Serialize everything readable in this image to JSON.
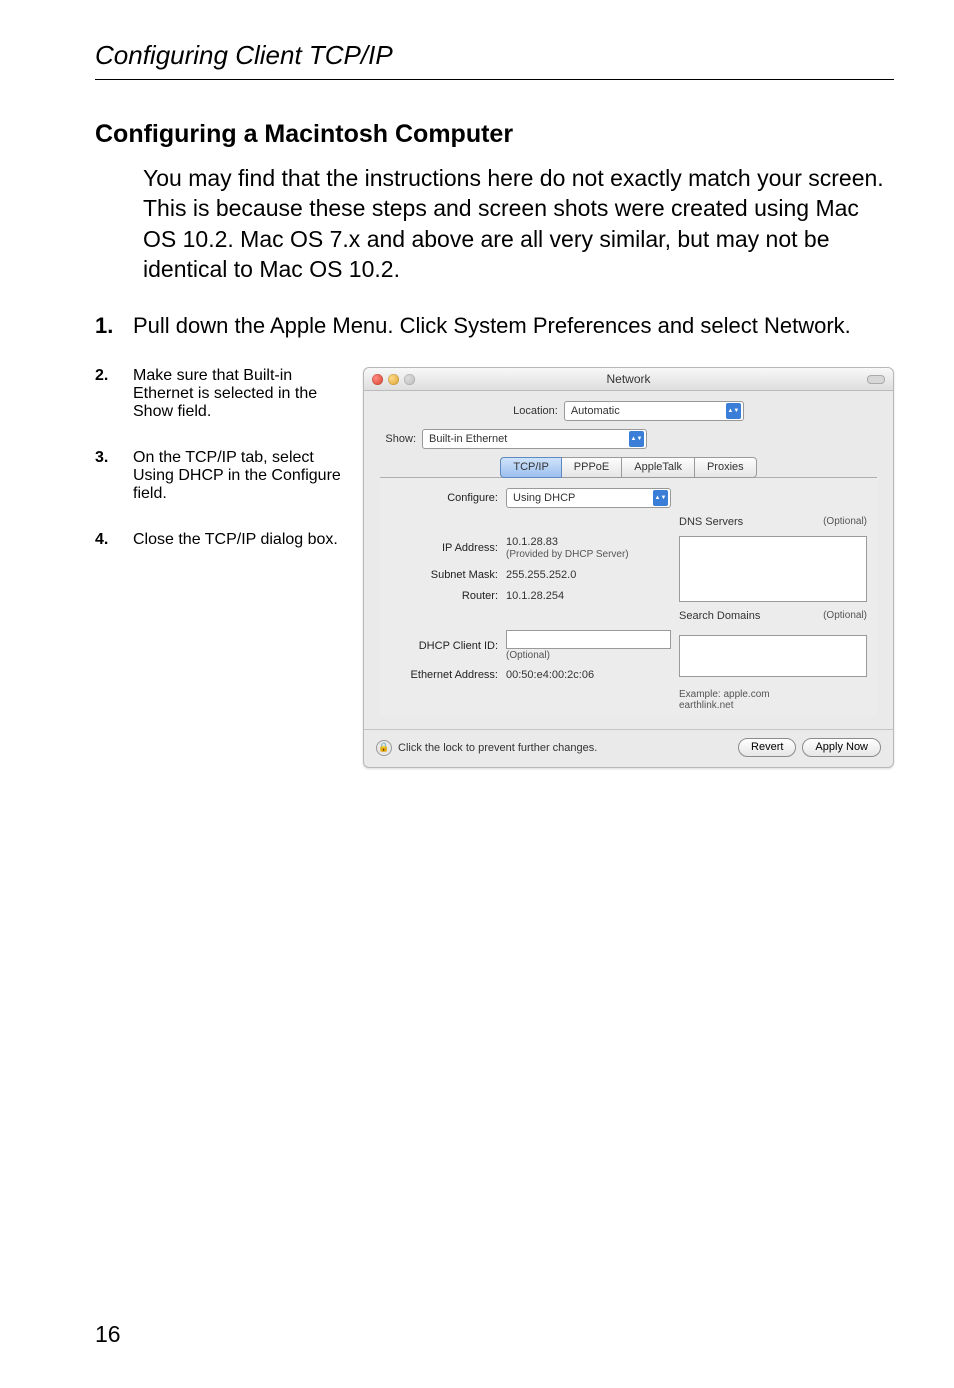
{
  "page_header": "Configuring Client TCP/IP",
  "section_title": "Configuring a Macintosh Computer",
  "intro": "You may find that the instructions here do not exactly match your screen. This is because these steps and screen shots were created using Mac OS 10.2. Mac OS 7.x and above are all very similar, but may not be identical to Mac OS 10.2.",
  "steps": [
    {
      "num": "1.",
      "text": "Pull down the Apple Menu. Click System Preferences and select Network."
    },
    {
      "num": "2.",
      "text": "Make sure that Built-in Ethernet is selected in the Show field."
    },
    {
      "num": "3.",
      "text": "On the TCP/IP tab, select Using DHCP in the Configure field."
    },
    {
      "num": "4.",
      "text": "Close the TCP/IP dialog box."
    }
  ],
  "window": {
    "title": "Network",
    "location_label": "Location:",
    "location_value": "Automatic",
    "show_label": "Show:",
    "show_value": "Built-in Ethernet",
    "tabs": [
      "TCP/IP",
      "PPPoE",
      "AppleTalk",
      "Proxies"
    ],
    "active_tab": "TCP/IP",
    "configure_label": "Configure:",
    "configure_value": "Using DHCP",
    "dns_label": "DNS Servers",
    "optional": "(Optional)",
    "ip_label": "IP Address:",
    "ip_value": "10.1.28.83",
    "ip_sub": "(Provided by DHCP Server)",
    "subnet_label": "Subnet Mask:",
    "subnet_value": "255.255.252.0",
    "router_label": "Router:",
    "router_value": "10.1.28.254",
    "search_label": "Search Domains",
    "dhcp_label": "DHCP Client ID:",
    "dhcp_sub": "(Optional)",
    "eth_label": "Ethernet Address:",
    "eth_value": "00:50:e4:00:2c:06",
    "example_label": "Example:",
    "example_lines": "apple.com\nearthlink.net",
    "lock_msg": "Click the lock to prevent further changes.",
    "revert": "Revert",
    "apply": "Apply Now"
  },
  "page_number": "16"
}
